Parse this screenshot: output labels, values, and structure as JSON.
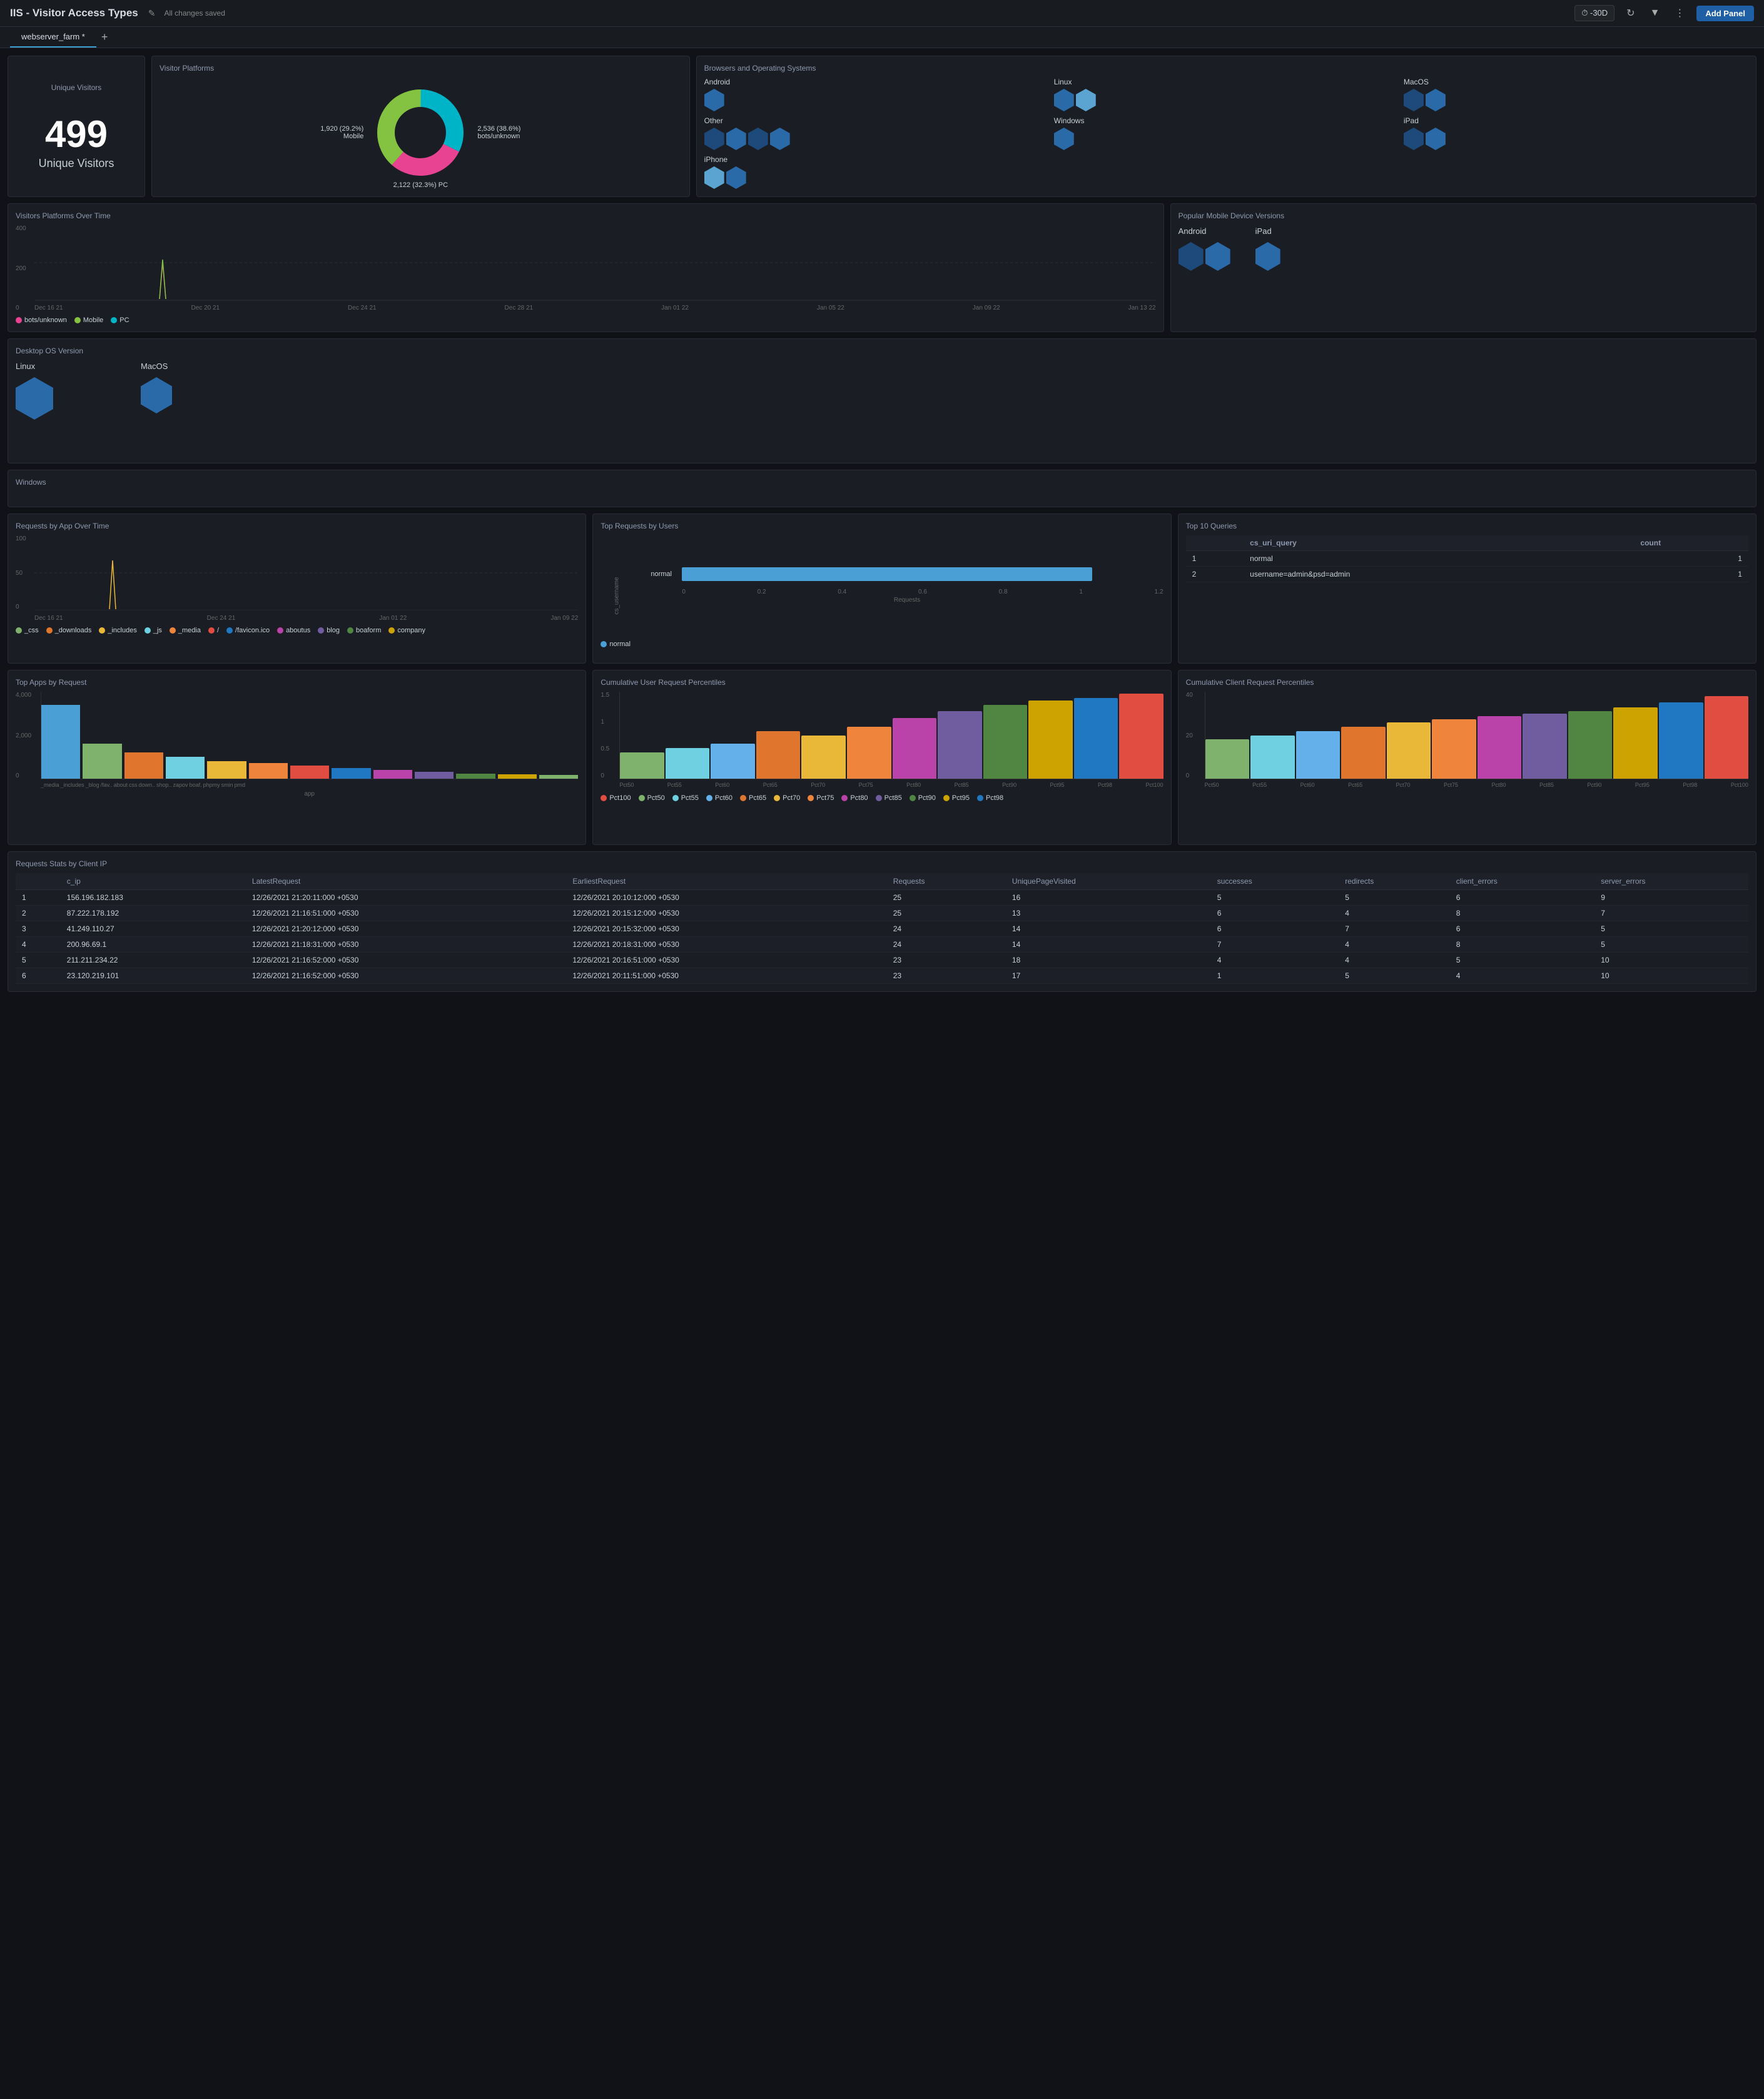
{
  "header": {
    "title": "IIS - Visitor Access Types",
    "saved_status": "All changes saved",
    "timerange": "⏱ -30D",
    "add_panel_label": "Add Panel"
  },
  "tabs": [
    {
      "label": "webserver_farm *",
      "active": true
    }
  ],
  "panels": {
    "unique_visitors": {
      "title": "Unique Visitors",
      "count": "499",
      "label": "Unique Visitors"
    },
    "visitor_platforms": {
      "title": "Visitor Platforms",
      "segments": [
        {
          "label": "1,920 (29.2%)\nMobile",
          "color": "#e84393",
          "value": 29.2
        },
        {
          "label": "2,536 (38.6%)\nbots/unknown",
          "color": "#84c341",
          "value": 38.6
        },
        {
          "label": "2,122 (32.3%) PC",
          "color": "#00b4c8",
          "value": 32.3
        }
      ]
    },
    "browsers_os": {
      "title": "Browsers and Operating Systems",
      "items": [
        {
          "label": "Android",
          "hexes": [
            {
              "color": "mid"
            }
          ]
        },
        {
          "label": "Linux",
          "hexes": [
            {
              "color": "mid"
            },
            {
              "color": "light"
            }
          ]
        },
        {
          "label": "MacOS",
          "hexes": [
            {
              "color": "dark"
            },
            {
              "color": "mid"
            }
          ]
        },
        {
          "label": "Other",
          "hexes": [
            {
              "color": "dark"
            },
            {
              "color": "mid"
            },
            {
              "color": "dark"
            },
            {
              "color": "mid"
            }
          ]
        },
        {
          "label": "Windows",
          "hexes": [
            {
              "color": "mid"
            }
          ]
        },
        {
          "label": "iPad",
          "hexes": [
            {
              "color": "dark"
            },
            {
              "color": "mid"
            }
          ]
        },
        {
          "label": "iPhone",
          "hexes": [
            {
              "color": "light"
            },
            {
              "color": "mid"
            }
          ]
        }
      ]
    },
    "visitors_over_time": {
      "title": "Visitors Platforms Over Time",
      "y_labels": [
        "400",
        "200",
        "0"
      ],
      "x_labels": [
        "Dec 16 21",
        "Dec 20 21",
        "Dec 24 21",
        "Dec 28 21",
        "Jan 01 22",
        "Jan 05 22",
        "Jan 09 22",
        "Jan 13 22"
      ],
      "legend": [
        {
          "label": "bots/unknown",
          "color": "#e84393"
        },
        {
          "label": "Mobile",
          "color": "#84c341"
        },
        {
          "label": "PC",
          "color": "#00b4c8"
        }
      ]
    },
    "popular_mobile": {
      "title": "Popular Mobile Device Versions",
      "items": [
        {
          "label": "Android",
          "hexes": [
            {
              "color": "dark",
              "size": "lg"
            },
            {
              "color": "mid",
              "size": "lg"
            }
          ]
        },
        {
          "label": "iPad",
          "hexes": [
            {
              "color": "mid",
              "size": "lg"
            }
          ]
        }
      ]
    },
    "desktop_os": {
      "title": "Desktop OS Version",
      "items": [
        {
          "label": "Linux",
          "hex_color": "mid"
        },
        {
          "label": "MacOS",
          "hex_color": "mid"
        }
      ]
    },
    "windows_label": "Windows",
    "requests_app_over_time": {
      "title": "Requests by App Over Time",
      "y_labels": [
        "100",
        "50",
        "0"
      ],
      "x_labels": [
        "Dec 16 21",
        "Dec 24 21",
        "Jan 01 22",
        "Jan 09 22"
      ],
      "legend": [
        {
          "label": "_css",
          "color": "#7eb26d"
        },
        {
          "label": "_downloads",
          "color": "#e0752d"
        },
        {
          "label": "_includes",
          "color": "#eab839"
        },
        {
          "label": "_js",
          "color": "#6ed0e0"
        },
        {
          "label": "_media",
          "color": "#ef843c"
        },
        {
          "label": "/",
          "color": "#e24d42"
        },
        {
          "label": "/favicon.ico",
          "color": "#1f78c1"
        },
        {
          "label": "aboutus",
          "color": "#ba43a9"
        },
        {
          "label": "blog",
          "color": "#705da0"
        },
        {
          "label": "boaform",
          "color": "#508642"
        },
        {
          "label": "company",
          "color": "#cca300"
        }
      ]
    },
    "top_requests_users": {
      "title": "Top Requests by Users",
      "y_label": "cs_username",
      "x_labels": [
        "0",
        "0.2",
        "0.4",
        "0.6",
        "0.8",
        "1",
        "1.2"
      ],
      "x_axis_label": "Requests",
      "bars": [
        {
          "label": "normal",
          "value": 1.0,
          "color": "#4a9fd4"
        }
      ],
      "legend": [
        {
          "label": "normal",
          "color": "#4a9fd4"
        }
      ]
    },
    "top_queries": {
      "title": "Top 10 Queries",
      "columns": [
        "cs_uri_query",
        "count"
      ],
      "rows": [
        {
          "num": "1",
          "query": "normal",
          "count": "1"
        },
        {
          "num": "2",
          "query": "username=admin&psd=admin",
          "count": "1"
        }
      ]
    },
    "top_apps_request": {
      "title": "Top Apps by Request",
      "y_labels": [
        "4,000",
        "2,000",
        "0"
      ],
      "x_label": "app",
      "bars": [
        {
          "label": "_media",
          "value": 85,
          "color": "#7eb26d"
        },
        {
          "label": "_includes",
          "value": 40,
          "color": "#e0752d"
        },
        {
          "label": "_blog",
          "value": 30,
          "color": "#eab839"
        },
        {
          "label": "/favicon.ico",
          "value": 25,
          "color": "#6ed0e0"
        },
        {
          "label": "aboutus",
          "value": 20,
          "color": "#ef843c"
        },
        {
          "label": "css",
          "value": 18,
          "color": "#e24d42"
        },
        {
          "label": "downloads",
          "value": 15,
          "color": "#1f78c1"
        },
        {
          "label": "shopping",
          "value": 12,
          "color": "#ba43a9"
        },
        {
          "label": "zapov",
          "value": 8,
          "color": "#705da0"
        },
        {
          "label": "boaform",
          "value": 7,
          "color": "#508642"
        },
        {
          "label": "phpmy",
          "value": 5,
          "color": "#cca300"
        },
        {
          "label": "smin",
          "value": 4,
          "color": "#7eb26d"
        },
        {
          "label": "pmd",
          "value": 3,
          "color": "#e0752d"
        }
      ]
    },
    "cumulative_user": {
      "title": "Cumulative User Request Percentiles",
      "y_labels": [
        "1.5",
        "1",
        "0.5",
        "0"
      ],
      "x_labels": [
        "Pct50",
        "Pct55",
        "Pct60",
        "Pct65",
        "Pct70",
        "Pct75",
        "Pct80",
        "Pct85",
        "Pct90",
        "Pct95",
        "Pct98",
        "Pct100"
      ],
      "bars": [
        {
          "label": "Pct50",
          "value": 30,
          "color": "#7eb26d"
        },
        {
          "label": "Pct55",
          "value": 35,
          "color": "#6ed0e0"
        },
        {
          "label": "Pct60",
          "value": 40,
          "color": "#64b0eb"
        },
        {
          "label": "Pct65",
          "value": 55,
          "color": "#e0752d"
        },
        {
          "label": "Pct70",
          "value": 50,
          "color": "#eab839"
        },
        {
          "label": "Pct75",
          "value": 60,
          "color": "#ef843c"
        },
        {
          "label": "Pct80",
          "value": 70,
          "color": "#ba43a9"
        },
        {
          "label": "Pct85",
          "value": 78,
          "color": "#705da0"
        },
        {
          "label": "Pct90",
          "value": 85,
          "color": "#508642"
        },
        {
          "label": "Pct95",
          "value": 90,
          "color": "#cca300"
        },
        {
          "label": "Pct98",
          "value": 93,
          "color": "#1f78c1"
        },
        {
          "label": "Pct100",
          "value": 98,
          "color": "#e24d42"
        }
      ],
      "legend": [
        {
          "label": "Pct100",
          "color": "#e24d42"
        },
        {
          "label": "Pct50",
          "color": "#7eb26d"
        },
        {
          "label": "Pct55",
          "color": "#6ed0e0"
        },
        {
          "label": "Pct60",
          "color": "#64b0eb"
        },
        {
          "label": "Pct65",
          "color": "#e0752d"
        },
        {
          "label": "Pct70",
          "color": "#eab839"
        },
        {
          "label": "Pct75",
          "color": "#ef843c"
        },
        {
          "label": "Pct80",
          "color": "#ba43a9"
        },
        {
          "label": "Pct85",
          "color": "#705da0"
        },
        {
          "label": "Pct90",
          "color": "#508642"
        },
        {
          "label": "Pct95",
          "color": "#cca300"
        },
        {
          "label": "Pct98",
          "color": "#1f78c1"
        }
      ]
    },
    "cumulative_client": {
      "title": "Cumulative Client Request Percentiles",
      "y_labels": [
        "40",
        "20",
        "0"
      ],
      "x_labels": [
        "Pct50",
        "Pct55",
        "Pct60",
        "Pct65",
        "Pct70",
        "Pct75",
        "Pct80",
        "Pct85",
        "Pct90",
        "Pct95",
        "Pct98",
        "Pct100"
      ],
      "bars": [
        {
          "label": "Pct50",
          "value": 45,
          "color": "#7eb26d"
        },
        {
          "label": "Pct55",
          "value": 50,
          "color": "#6ed0e0"
        },
        {
          "label": "Pct60",
          "value": 55,
          "color": "#64b0eb"
        },
        {
          "label": "Pct65",
          "value": 60,
          "color": "#e0752d"
        },
        {
          "label": "Pct70",
          "value": 65,
          "color": "#eab839"
        },
        {
          "label": "Pct75",
          "value": 68,
          "color": "#ef843c"
        },
        {
          "label": "Pct80",
          "value": 72,
          "color": "#ba43a9"
        },
        {
          "label": "Pct85",
          "value": 75,
          "color": "#705da0"
        },
        {
          "label": "Pct90",
          "value": 78,
          "color": "#508642"
        },
        {
          "label": "Pct95",
          "value": 82,
          "color": "#cca300"
        },
        {
          "label": "Pct98",
          "value": 88,
          "color": "#1f78c1"
        },
        {
          "label": "Pct100",
          "value": 95,
          "color": "#e24d42"
        }
      ]
    },
    "client_ip_stats": {
      "title": "Requests Stats by Client IP",
      "columns": [
        "c_ip",
        "LatestRequest",
        "EarliestRequest",
        "Requests",
        "UniquePageVisited",
        "successes",
        "redirects",
        "client_errors",
        "server_errors"
      ],
      "rows": [
        {
          "num": "1",
          "c_ip": "156.196.182.183",
          "latest": "12/26/2021 21:20:11:000 +0530",
          "earliest": "12/26/2021 20:10:12:000 +0530",
          "requests": "25",
          "pages": "16",
          "successes": "5",
          "redirects": "5",
          "client_errors": "6",
          "server_errors": "9"
        },
        {
          "num": "2",
          "c_ip": "87.222.178.192",
          "latest": "12/26/2021 21:16:51:000 +0530",
          "earliest": "12/26/2021 20:15:12:000 +0530",
          "requests": "25",
          "pages": "13",
          "successes": "6",
          "redirects": "4",
          "client_errors": "8",
          "server_errors": "7"
        },
        {
          "num": "3",
          "c_ip": "41.249.110.27",
          "latest": "12/26/2021 21:20:12:000 +0530",
          "earliest": "12/26/2021 20:15:32:000 +0530",
          "requests": "24",
          "pages": "14",
          "successes": "6",
          "redirects": "7",
          "client_errors": "6",
          "server_errors": "5"
        },
        {
          "num": "4",
          "c_ip": "200.96.69.1",
          "latest": "12/26/2021 21:18:31:000 +0530",
          "earliest": "12/26/2021 20:18:31:000 +0530",
          "requests": "24",
          "pages": "14",
          "successes": "7",
          "redirects": "4",
          "client_errors": "8",
          "server_errors": "5"
        },
        {
          "num": "5",
          "c_ip": "211.211.234.22",
          "latest": "12/26/2021 21:16:52:000 +0530",
          "earliest": "12/26/2021 20:16:51:000 +0530",
          "requests": "23",
          "pages": "18",
          "successes": "4",
          "redirects": "4",
          "client_errors": "5",
          "server_errors": "10"
        },
        {
          "num": "6",
          "c_ip": "23.120.219.101",
          "latest": "12/26/2021 21:16:52:000 +0530",
          "earliest": "12/26/2021 20:11:51:000 +0530",
          "requests": "23",
          "pages": "17",
          "successes": "1",
          "redirects": "5",
          "client_errors": "4",
          "server_errors": "10"
        }
      ]
    }
  }
}
